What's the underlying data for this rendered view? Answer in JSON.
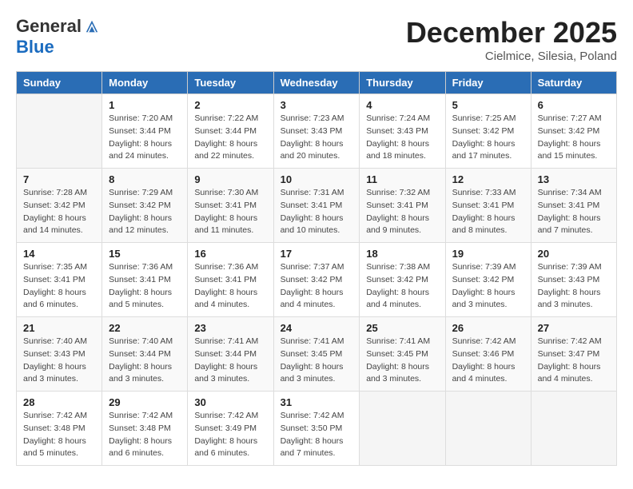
{
  "header": {
    "logo_general": "General",
    "logo_blue": "Blue",
    "month": "December 2025",
    "location": "Cielmice, Silesia, Poland"
  },
  "days_of_week": [
    "Sunday",
    "Monday",
    "Tuesday",
    "Wednesday",
    "Thursday",
    "Friday",
    "Saturday"
  ],
  "weeks": [
    [
      {
        "day": "",
        "info": ""
      },
      {
        "day": "1",
        "info": "Sunrise: 7:20 AM\nSunset: 3:44 PM\nDaylight: 8 hours\nand 24 minutes."
      },
      {
        "day": "2",
        "info": "Sunrise: 7:22 AM\nSunset: 3:44 PM\nDaylight: 8 hours\nand 22 minutes."
      },
      {
        "day": "3",
        "info": "Sunrise: 7:23 AM\nSunset: 3:43 PM\nDaylight: 8 hours\nand 20 minutes."
      },
      {
        "day": "4",
        "info": "Sunrise: 7:24 AM\nSunset: 3:43 PM\nDaylight: 8 hours\nand 18 minutes."
      },
      {
        "day": "5",
        "info": "Sunrise: 7:25 AM\nSunset: 3:42 PM\nDaylight: 8 hours\nand 17 minutes."
      },
      {
        "day": "6",
        "info": "Sunrise: 7:27 AM\nSunset: 3:42 PM\nDaylight: 8 hours\nand 15 minutes."
      }
    ],
    [
      {
        "day": "7",
        "info": "Sunrise: 7:28 AM\nSunset: 3:42 PM\nDaylight: 8 hours\nand 14 minutes."
      },
      {
        "day": "8",
        "info": "Sunrise: 7:29 AM\nSunset: 3:42 PM\nDaylight: 8 hours\nand 12 minutes."
      },
      {
        "day": "9",
        "info": "Sunrise: 7:30 AM\nSunset: 3:41 PM\nDaylight: 8 hours\nand 11 minutes."
      },
      {
        "day": "10",
        "info": "Sunrise: 7:31 AM\nSunset: 3:41 PM\nDaylight: 8 hours\nand 10 minutes."
      },
      {
        "day": "11",
        "info": "Sunrise: 7:32 AM\nSunset: 3:41 PM\nDaylight: 8 hours\nand 9 minutes."
      },
      {
        "day": "12",
        "info": "Sunrise: 7:33 AM\nSunset: 3:41 PM\nDaylight: 8 hours\nand 8 minutes."
      },
      {
        "day": "13",
        "info": "Sunrise: 7:34 AM\nSunset: 3:41 PM\nDaylight: 8 hours\nand 7 minutes."
      }
    ],
    [
      {
        "day": "14",
        "info": "Sunrise: 7:35 AM\nSunset: 3:41 PM\nDaylight: 8 hours\nand 6 minutes."
      },
      {
        "day": "15",
        "info": "Sunrise: 7:36 AM\nSunset: 3:41 PM\nDaylight: 8 hours\nand 5 minutes."
      },
      {
        "day": "16",
        "info": "Sunrise: 7:36 AM\nSunset: 3:41 PM\nDaylight: 8 hours\nand 4 minutes."
      },
      {
        "day": "17",
        "info": "Sunrise: 7:37 AM\nSunset: 3:42 PM\nDaylight: 8 hours\nand 4 minutes."
      },
      {
        "day": "18",
        "info": "Sunrise: 7:38 AM\nSunset: 3:42 PM\nDaylight: 8 hours\nand 4 minutes."
      },
      {
        "day": "19",
        "info": "Sunrise: 7:39 AM\nSunset: 3:42 PM\nDaylight: 8 hours\nand 3 minutes."
      },
      {
        "day": "20",
        "info": "Sunrise: 7:39 AM\nSunset: 3:43 PM\nDaylight: 8 hours\nand 3 minutes."
      }
    ],
    [
      {
        "day": "21",
        "info": "Sunrise: 7:40 AM\nSunset: 3:43 PM\nDaylight: 8 hours\nand 3 minutes."
      },
      {
        "day": "22",
        "info": "Sunrise: 7:40 AM\nSunset: 3:44 PM\nDaylight: 8 hours\nand 3 minutes."
      },
      {
        "day": "23",
        "info": "Sunrise: 7:41 AM\nSunset: 3:44 PM\nDaylight: 8 hours\nand 3 minutes."
      },
      {
        "day": "24",
        "info": "Sunrise: 7:41 AM\nSunset: 3:45 PM\nDaylight: 8 hours\nand 3 minutes."
      },
      {
        "day": "25",
        "info": "Sunrise: 7:41 AM\nSunset: 3:45 PM\nDaylight: 8 hours\nand 3 minutes."
      },
      {
        "day": "26",
        "info": "Sunrise: 7:42 AM\nSunset: 3:46 PM\nDaylight: 8 hours\nand 4 minutes."
      },
      {
        "day": "27",
        "info": "Sunrise: 7:42 AM\nSunset: 3:47 PM\nDaylight: 8 hours\nand 4 minutes."
      }
    ],
    [
      {
        "day": "28",
        "info": "Sunrise: 7:42 AM\nSunset: 3:48 PM\nDaylight: 8 hours\nand 5 minutes."
      },
      {
        "day": "29",
        "info": "Sunrise: 7:42 AM\nSunset: 3:48 PM\nDaylight: 8 hours\nand 6 minutes."
      },
      {
        "day": "30",
        "info": "Sunrise: 7:42 AM\nSunset: 3:49 PM\nDaylight: 8 hours\nand 6 minutes."
      },
      {
        "day": "31",
        "info": "Sunrise: 7:42 AM\nSunset: 3:50 PM\nDaylight: 8 hours\nand 7 minutes."
      },
      {
        "day": "",
        "info": ""
      },
      {
        "day": "",
        "info": ""
      },
      {
        "day": "",
        "info": ""
      }
    ]
  ]
}
